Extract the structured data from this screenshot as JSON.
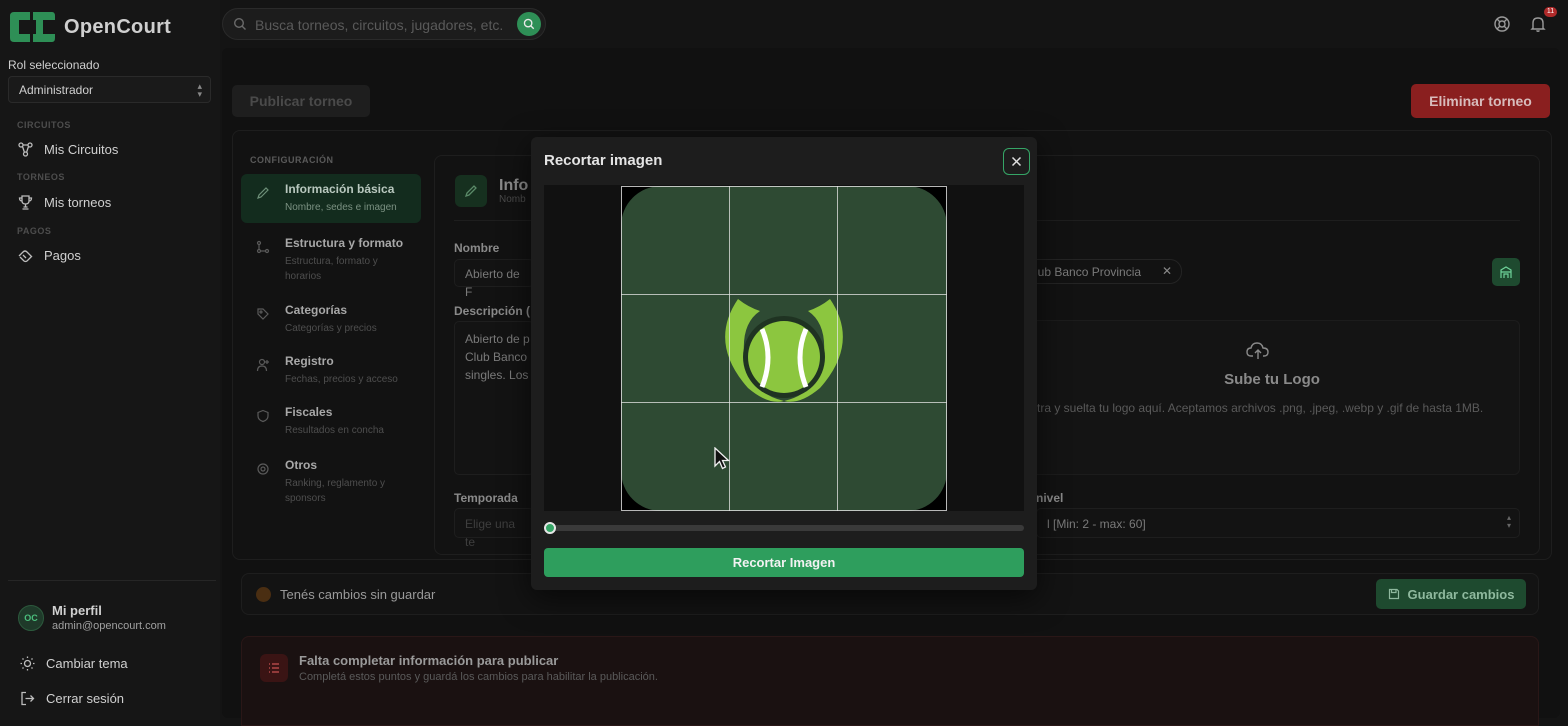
{
  "app": {
    "name": "OpenCourt"
  },
  "search": {
    "placeholder": "Busca torneos, circuitos, jugadores, etc."
  },
  "notifications": {
    "count": "11"
  },
  "sidebar": {
    "role_label": "Rol seleccionado",
    "role_value": "Administrador",
    "sections": [
      {
        "label": "CIRCUITOS",
        "item": "Mis Circuitos"
      },
      {
        "label": "TORNEOS",
        "item": "Mis torneos"
      },
      {
        "label": "PAGOS",
        "item": "Pagos"
      }
    ],
    "profile": {
      "name": "Mi perfil",
      "email": "admin@opencourt.com"
    },
    "theme": "Cambiar tema",
    "logout": "Cerrar sesión"
  },
  "actions": {
    "publish": "Publicar torneo",
    "delete": "Eliminar torneo"
  },
  "config": {
    "label": "CONFIGURACIÓN",
    "steps": [
      {
        "title": "Información básica",
        "subtitle": "Nombre, sedes e imagen"
      },
      {
        "title": "Estructura y formato",
        "subtitle": "Estructura, formato y horarios"
      },
      {
        "title": "Categorías",
        "subtitle": "Categorías y precios"
      },
      {
        "title": "Registro",
        "subtitle": "Fechas, precios y acceso"
      },
      {
        "title": "Fiscales",
        "subtitle": "Resultados en concha"
      },
      {
        "title": "Otros",
        "subtitle": "Ranking, reglamento y sponsors"
      }
    ]
  },
  "form": {
    "section_title": "Info",
    "section_subtitle": "Nomb",
    "name_label": "Nombre",
    "name_value": "Abierto de F",
    "description_label": "Descripción (",
    "description_value": "Abierto de p\nClub Banco\nsingles. Los",
    "venue_chip": "lub Banco Provincia",
    "upload_title": "Sube tu Logo",
    "upload_desc": "stra y suelta tu logo aquí. Aceptamos archivos .png, .jpeg, .webp y .gif de hasta 1MB.",
    "season_label": "Temporada",
    "season_placeholder": "Elige una te",
    "level_label": "nivel",
    "level_value": "l [Min: 2 - max: 60]"
  },
  "save_bar": {
    "warning": "Tenés cambios sin guardar",
    "button": "Guardar cambios"
  },
  "alert": {
    "title": "Falta completar información para publicar",
    "desc": "Completá estos puntos y guardá los cambios para habilitar la publicación."
  },
  "modal": {
    "title": "Recortar imagen",
    "zoom": 0,
    "crop_button": "Recortar Imagen"
  },
  "colors": {
    "accent": "#2e9e5d",
    "danger": "#8a1f1f",
    "tile": "#2e4a33",
    "ball": "#8cc63f"
  }
}
